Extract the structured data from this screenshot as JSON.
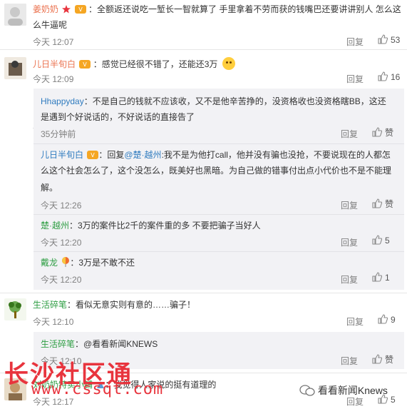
{
  "comments": [
    {
      "author": "姜奶奶",
      "text_line1": "：全额返还说吃一堑长一智就算了 手里拿着不劳而获的钱嘴巴还要讲讲别人 怎么这",
      "text_line2": "么牛逼呢",
      "time": "今天 12:07",
      "reply_label": "回复",
      "like_count": "53"
    },
    {
      "author": "儿日半旬白",
      "text": "：感觉已经很不错了，还能还3万",
      "time": "今天 12:09",
      "reply_label": "回复",
      "like_count": "16",
      "replies": [
        {
          "author": "Hhappyday",
          "text_line1": "：不是自己的钱就不应该收，又不是他辛苦挣的，没资格收也没资格瞎BB，这还",
          "text_line2": "是遇到个好说话的，不好说话的直接告了",
          "time": "35分钟前",
          "reply_label": "回复",
          "like_label": "赞"
        },
        {
          "author": "儿日半旬白",
          "mention": "@楚·越州",
          "text_line1_prefix": "：回复",
          "text_line1_suffix": ":我不是为他打call，他并没有骗也没抢，不要说现在的人都怎",
          "text_line2": "么这个社会怎么了，这个没怎么，既美好也黑暗。为自己做的错事付出点小代价也不是不能理",
          "text_line3": "解。",
          "time": "今天 12:26",
          "reply_label": "回复",
          "like_label": "赞"
        },
        {
          "author": "楚·越州",
          "text": "：3万的案件比2千的案件重的多 不要把骗子当好人",
          "time": "今天 12:20",
          "reply_label": "回复",
          "like_count": "5"
        },
        {
          "author": "戴龙",
          "text": "：3万是不敢不还",
          "time": "今天 12:20",
          "reply_label": "回复",
          "like_count": "1"
        }
      ]
    },
    {
      "author": "生活碎笔",
      "text": "：看似无意实则有意的……骗子！",
      "time": "今天 12:10",
      "reply_label": "回复",
      "like_count": "9",
      "replies": [
        {
          "author": "生活碎笔",
          "text": "：@看看新闻KNEWS",
          "time": "今天 12:10",
          "reply_label": "回复",
          "like_label": "赞"
        }
      ]
    },
    {
      "author": "刘奶奶特卖小铺",
      "text": "：我觉得人家说的挺有道理的",
      "time": "今天 12:17",
      "reply_label": "回复",
      "like_count": "5"
    }
  ],
  "watermark": {
    "title": "长沙社区通",
    "url": "www.cssqt.com",
    "logo_text": "看看新闻Knews"
  },
  "icons": {
    "like": "thumbs-up-icon",
    "star": "star-icon",
    "vip": "vip-badge-icon"
  }
}
